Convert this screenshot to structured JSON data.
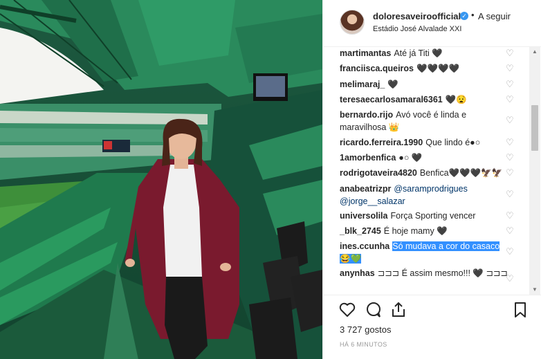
{
  "post": {
    "username": "doloresaveiroofficial",
    "dot": "•",
    "follow_label": "A seguir",
    "location": "Estádio José Alvalade XXI",
    "verified_glyph": "✓"
  },
  "comments": [
    {
      "user": "martimantas",
      "text": "Até já Titi 🖤"
    },
    {
      "user": "franciisca.queiros",
      "text": "🖤🖤🖤🖤"
    },
    {
      "user": "melimaraj_",
      "text": "🖤"
    },
    {
      "user": "teresaecarlosamaral6361",
      "text": "🖤😧"
    },
    {
      "user": "bernardo.rijo",
      "text": "Avó você é linda e maravilhosa 👑"
    },
    {
      "user": "ricardo.ferreira.1990",
      "text": "Que lindo é●○"
    },
    {
      "user": "1amorbenfica",
      "text": "●○ 🖤"
    },
    {
      "user": "rodrigotaveira4820",
      "text": "Benfica🖤🖤🖤🦅🦅"
    },
    {
      "user": "anabeatrizpr",
      "mention1": "@saramprodrigues",
      "mention2": "@jorge__salazar"
    },
    {
      "user": "universolila",
      "text": "Força Sporting vencer"
    },
    {
      "user": "_blk_2745",
      "text": "É hoje mamy 🖤"
    },
    {
      "user": "ines.ccunha",
      "text": "Só mudava a cor do casaco 😂💚"
    },
    {
      "user": "anynhas",
      "text": "⊐⊐⊐ É assim mesmo!!! 🖤 ⊐⊐⊐"
    }
  ],
  "likes": "3 727 gostos",
  "time": "HÁ 6 MINUTOS",
  "icons": {
    "heart": "heart-icon",
    "comment": "comment-icon",
    "share": "share-icon",
    "bookmark": "bookmark-icon"
  },
  "colors": {
    "accent_blue": "#3897f0",
    "selection": "#3390ff",
    "mention": "#003569",
    "stadium_green": "#1f7a4d"
  }
}
